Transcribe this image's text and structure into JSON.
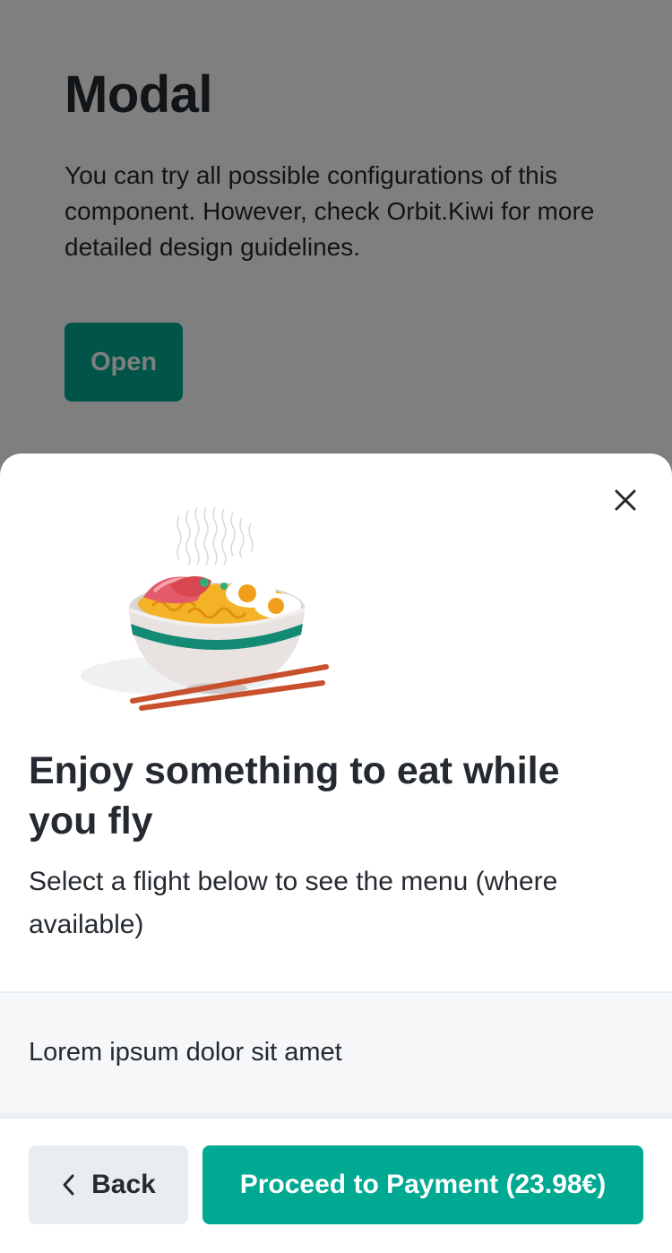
{
  "page": {
    "title": "Modal",
    "description": "You can try all possible configurations of this component. However, check Orbit.Kiwi for more detailed design guidelines.",
    "open_label": "Open"
  },
  "modal": {
    "illustration": "noodle-bowl-illustration",
    "title": "Enjoy something to eat while you fly",
    "description": "Select a flight below to see the menu (where available)",
    "section_text": "Lorem ipsum dolor sit amet",
    "back_label": "Back",
    "proceed_label": "Proceed to Payment (23.98€)"
  },
  "colors": {
    "primary": "#00a991",
    "ink": "#252a31",
    "secondary_button": "#e8edf1",
    "section_background": "#f5f7f9",
    "overlay": "rgba(0,0,0,0.5)"
  },
  "icons": {
    "close": "close-icon",
    "back": "chevron-left-icon"
  }
}
